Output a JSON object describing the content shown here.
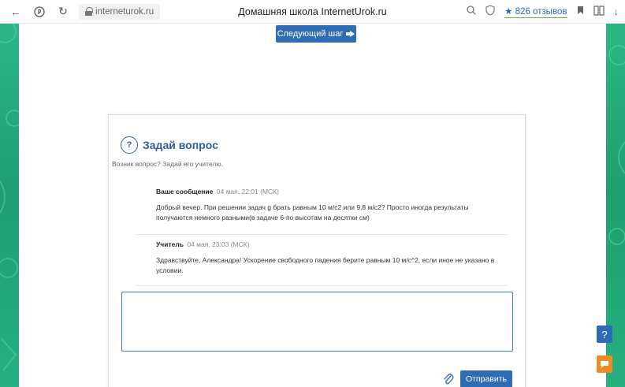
{
  "browser": {
    "url": "interneturok.ru",
    "tab_title": "Домашняя школа InternetUrok.ru",
    "reviews": "★ 826 отзывов"
  },
  "toolbar": {
    "next_step_label": "Следующий шаг"
  },
  "card": {
    "title": "Задай вопрос",
    "subtitle": "Возник вопрос? Задай его учителю.",
    "messages": [
      {
        "author": "Ваше сообщение",
        "time": "04 мая, 22:01 (МСК)",
        "text": "Добрый вечер. При решении задач g брать равным 10 м/с2 или 9,8 м/с2? Просто иногда результаты получаются немного разными(в задаче 6-по высотам на десятки см)"
      },
      {
        "author": "Учитель",
        "time": "04 мая, 23:03 (МСК)",
        "text": "Здравствуйте, Александра! Ускорение свободного падения берите равным 10 м/с^2, если иное не указано в условии."
      }
    ],
    "textarea_value": "",
    "send_label": "Отправить"
  },
  "side": {
    "help_label": "?"
  },
  "colors": {
    "accent": "#2f6cb3",
    "title": "#2b5f9e",
    "background": "#22a87a",
    "chat": "#f08a24"
  }
}
